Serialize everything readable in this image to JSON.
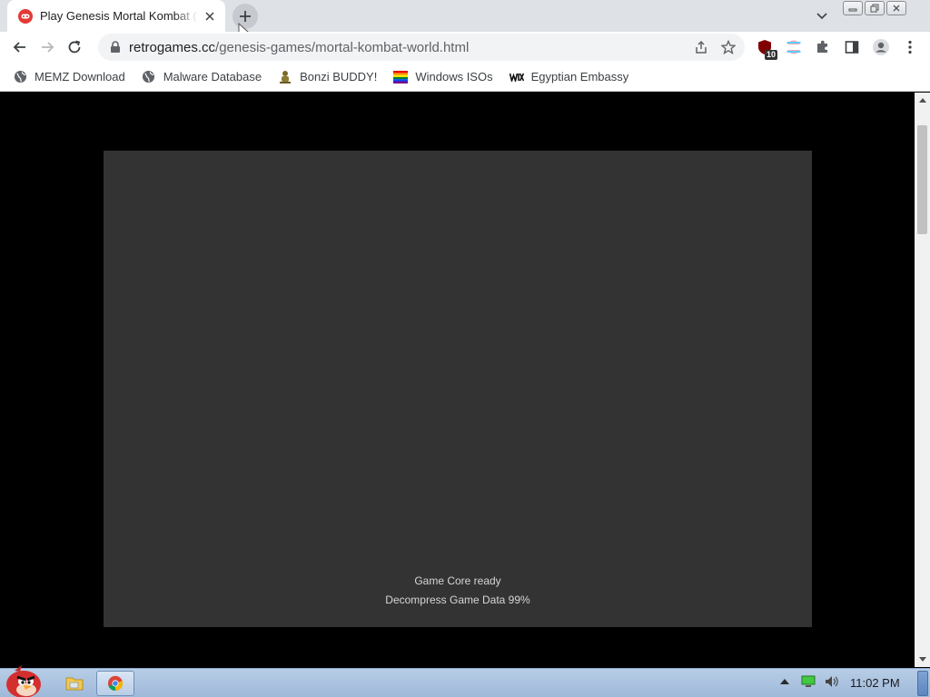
{
  "tab": {
    "title": "Play Genesis Mortal Kombat (World)"
  },
  "toolbar": {
    "url_host": "retrogames.cc",
    "url_path": "/genesis-games/mortal-kombat-world.html",
    "extension_badge": "10"
  },
  "bookmarks": [
    {
      "label": "MEMZ Download",
      "icon": "globe-icon"
    },
    {
      "label": "Malware Database",
      "icon": "globe-icon"
    },
    {
      "label": "Bonzi BUDDY!",
      "icon": "bonzi-icon"
    },
    {
      "label": "Windows ISOs",
      "icon": "rainbow-flag-icon"
    },
    {
      "label": "Egyptian Embassy",
      "icon": "wix-icon"
    }
  ],
  "game": {
    "status_line_1": "Game Core ready",
    "status_line_2": "Decompress Game Data 99%"
  },
  "taskbar": {
    "clock": "11:02 PM"
  },
  "colors": {
    "tab_favicon": "#e53935",
    "canvas": "#333333",
    "page_bg": "#000000",
    "taskbar": "#a9c3e2"
  }
}
